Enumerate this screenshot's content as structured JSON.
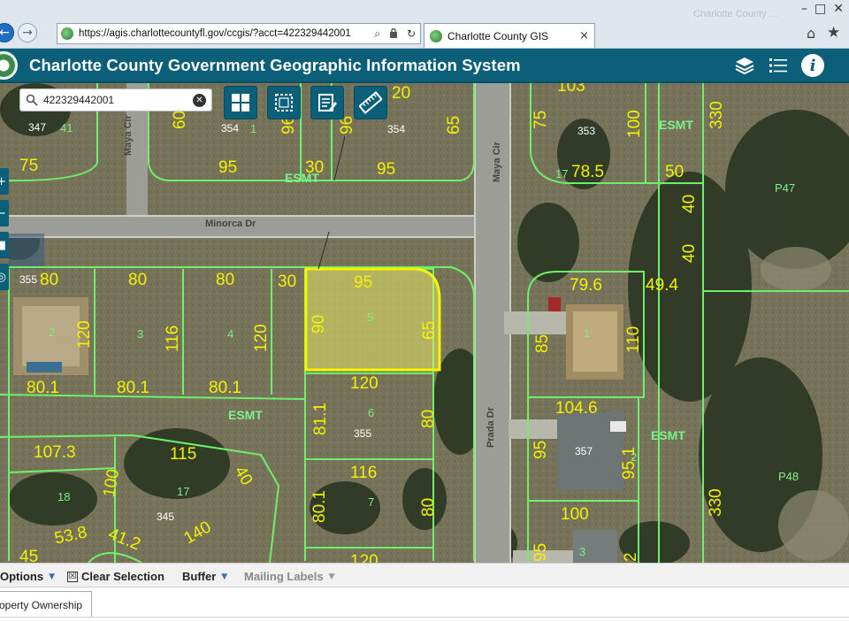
{
  "browser": {
    "url": "https://agis.charlottecountyfl.gov/ccgis/?acct=422329442001",
    "tab_title": "Charlotte County GIS",
    "ghost_tab": "Charlotte County ...",
    "tab_close": "×",
    "lock_icon": "lock-icon",
    "search_ctl": "⌕",
    "refresh_ctl": "↻",
    "back": "←",
    "forward": "→",
    "home_icon": "⌂",
    "star_icon": "★",
    "window_controls": [
      "–",
      "□",
      "✕"
    ]
  },
  "app": {
    "title": "Charlotte County Government Geographic Information System",
    "header_color": "#0c5f78",
    "info_glyph": "i"
  },
  "search": {
    "value": "422329442001",
    "clear": "✕"
  },
  "tools": [
    "grid-icon",
    "select-box-icon",
    "notes-icon",
    "measure-icon"
  ],
  "map": {
    "streets": [
      "Minorca Dr",
      "Maya Cir",
      "Maya Cir",
      "Prada Dr"
    ],
    "dimensions": [
      "103",
      "75",
      "100",
      "353",
      "17",
      "78.5",
      "50",
      "40",
      "40",
      "330",
      "65",
      "20",
      "354",
      "95",
      "95",
      "30",
      "96",
      "96",
      "60",
      "347",
      "41",
      "75",
      "354",
      "1",
      "ESMT",
      "80",
      "80",
      "30",
      "95",
      "90",
      "65",
      "120",
      "116",
      "120",
      "80.1",
      "80.1",
      "80.1",
      "120",
      "81.1",
      "80",
      "116",
      "80.1",
      "80",
      "107.3",
      "115",
      "100",
      "140",
      "53.8",
      "41.2",
      "45",
      "40",
      "79.6",
      "49.4",
      "85",
      "110",
      "104.6",
      "95",
      "95.1",
      "2",
      "100",
      "95",
      "2",
      "330",
      "120"
    ],
    "lot_numbers": [
      "2",
      "3",
      "4",
      "5",
      "6",
      "7",
      "17",
      "18",
      "1",
      "357",
      "3",
      "1"
    ],
    "addresses": [
      "355",
      "355",
      "345",
      "357",
      "353",
      "354",
      "347"
    ],
    "parcels": [
      "P47",
      "P48"
    ],
    "esmt": [
      "ESMT",
      "ESMT",
      "ESMT",
      "ESMT"
    ],
    "highlight_color": "#f5f500",
    "line_color": "#6ef06a"
  },
  "toolbar": {
    "options": "Options",
    "clear_selection": "Clear Selection",
    "buffer": "Buffer",
    "mailing_labels": "Mailing Labels",
    "caret": "▼",
    "checkbox": "☒"
  },
  "result_tab": {
    "label": "operty Ownership"
  }
}
